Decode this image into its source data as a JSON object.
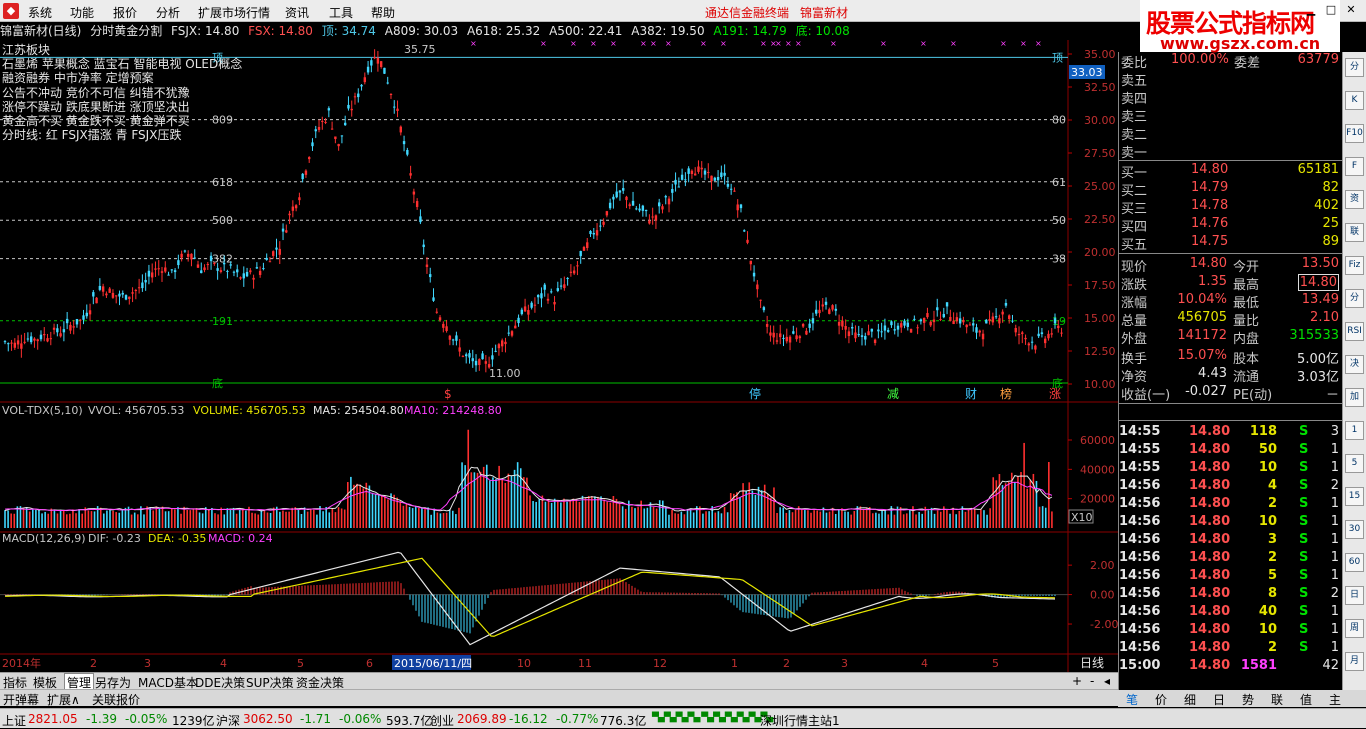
{
  "menu": {
    "items": [
      "系统",
      "功能",
      "报价",
      "分析",
      "扩展市场行情",
      "资讯",
      "工具",
      "帮助"
    ],
    "promo1": "通达信金融终端",
    "promo2": "锦富新材"
  },
  "banner": {
    "title": "股票公式指标网",
    "url": "www.gszx.com.cn"
  },
  "title": {
    "stock": "锦富新材(日线)",
    "indicator": "分时黄金分割",
    "fsjx": "FSJX: 14.80",
    "fsx": "FSX: 14.80",
    "top": "顶: 34.74",
    "a809": "A809: 30.03",
    "a618": "A618: 25.32",
    "a500": "A500: 22.41",
    "a382": "A382: 19.50",
    "a191": "A191: 14.79",
    "bottom": "底: 10.08"
  },
  "notes": [
    "江苏板块",
    "石墨烯 苹果概念 蓝宝石 智能电视 OLED概念",
    "融资融券 中市净率 定增预案",
    "公告不冲动 竞价不可信 纠错不犹豫",
    "涨停不躁动 跌底果断进 涨顶坚决出",
    "黄金高不买 黄金跌不买 黄金弹不买",
    "分时线: 红 FSJX擂涨 青 FSJX压跌"
  ],
  "chart_data": [
    {
      "type": "candlestick",
      "panel": "main",
      "y_axis_ticks": [
        "35.00",
        "32.50",
        "30.00",
        "27.50",
        "25.00",
        "22.50",
        "20.00",
        "17.50",
        "15.00",
        "12.50",
        "10.00"
      ],
      "ylim": [
        10,
        35.5
      ],
      "current_price_tag": "33.03",
      "high_label": "35.75",
      "low_label": "11.00",
      "levels": [
        {
          "value": 34.74,
          "left": "顶",
          "right": "顶",
          "color": "#4ec8e8"
        },
        {
          "value": 30.03,
          "left": "809",
          "right": "80",
          "color": "#c8c8c8"
        },
        {
          "value": 25.32,
          "left": "618",
          "right": "61",
          "color": "#c8c8c8"
        },
        {
          "value": 22.41,
          "left": "500",
          "right": "50",
          "color": "#c8c8c8"
        },
        {
          "value": 19.5,
          "left": "382",
          "right": "38",
          "color": "#c8c8c8"
        },
        {
          "value": 14.79,
          "left": "191",
          "right": "19",
          "color": "#00c000"
        },
        {
          "value": 10.08,
          "left": "底",
          "right": "底",
          "color": "#00c000"
        }
      ],
      "event_marks": [
        {
          "label": "$",
          "color": "#ff4040"
        },
        {
          "label": "停",
          "color": "#40c8ff"
        },
        {
          "label": "减",
          "color": "#40ff40"
        },
        {
          "label": "财",
          "color": "#40c8ff"
        },
        {
          "label": "榜",
          "color": "#ffa040"
        },
        {
          "label": "涨",
          "color": "#ff4040"
        }
      ],
      "close_path": [
        13.2,
        13.0,
        13.5,
        13.4,
        13.7,
        13.9,
        14.1,
        14.6,
        14.9,
        16.5,
        17.4,
        16.8,
        16.6,
        17.0,
        17.3,
        18.5,
        18.9,
        18.3,
        19.6,
        20.0,
        18.7,
        19.0,
        18.8,
        18.6,
        18.0,
        18.3,
        18.6,
        19.7,
        20.5,
        22.8,
        24.5,
        27.5,
        29.5,
        30.5,
        28.0,
        30.5,
        32.0,
        34.0,
        35.0,
        33.0,
        30.5,
        27.0,
        23.5,
        19.0,
        15.5,
        14.5,
        13.0,
        12.0,
        11.5,
        11.5,
        12.5,
        13.5,
        14.5,
        15.5,
        16.0,
        17.0,
        16.5,
        17.5,
        18.5,
        20.0,
        21.5,
        22.5,
        24.0,
        24.5,
        23.5,
        23.0,
        22.5,
        23.5,
        24.5,
        25.5,
        26.5,
        26.0,
        25.5,
        25.8,
        25.0,
        23.0,
        19.5,
        16.0,
        13.8,
        13.5,
        13.6,
        14.0,
        14.5,
        15.5,
        16.0,
        15.0,
        14.0,
        13.5,
        13.8,
        13.6,
        14.2,
        14.5,
        14.6,
        14.5,
        15.0,
        15.2,
        15.5,
        15.0,
        14.5,
        14.0,
        14.3,
        15.0,
        16.0,
        14.0,
        13.5,
        13.2,
        13.5,
        14.2
      ]
    },
    {
      "type": "bar",
      "panel": "volume",
      "title": "VOL-TDX(5,10)",
      "vvol": "VVOL: 456705.53",
      "volume": "VOLUME: 456705.53",
      "ma5": "MA5: 254504.80",
      "ma10": "MA10: 214248.80",
      "y_axis_ticks": [
        "60000",
        "40000",
        "20000"
      ],
      "unit": "X10",
      "ylim": [
        0,
        75000
      ]
    },
    {
      "type": "line",
      "panel": "macd",
      "title": "MACD(12,26,9)",
      "dif": "DIF: -0.23",
      "dea": "DEA: -0.35",
      "macd": "MACD: 0.24",
      "y_axis_ticks": [
        "2.00",
        "0.00",
        "-2.00"
      ],
      "ylim": [
        -3.9,
        3.3
      ]
    }
  ],
  "xaxis": {
    "labels": [
      "2014年",
      "2",
      "3",
      "4",
      "5",
      "6",
      "2015/06/11/四",
      "10",
      "11",
      "12",
      "1",
      "2",
      "3",
      "4",
      "5"
    ],
    "period": "日线"
  },
  "quote": {
    "ratio_label": "委比",
    "ratio": "100.00%",
    "diff_label": "委差",
    "diff": "63779",
    "sell": [
      {
        "label": "卖五"
      },
      {
        "label": "卖四"
      },
      {
        "label": "卖三"
      },
      {
        "label": "卖二"
      },
      {
        "label": "卖一"
      }
    ],
    "buy": [
      {
        "label": "买一",
        "price": "14.80",
        "vol": "65181"
      },
      {
        "label": "买二",
        "price": "14.79",
        "vol": "82"
      },
      {
        "label": "买三",
        "price": "14.78",
        "vol": "402"
      },
      {
        "label": "买四",
        "price": "14.76",
        "vol": "25"
      },
      {
        "label": "买五",
        "price": "14.75",
        "vol": "89"
      }
    ],
    "stats": [
      {
        "l1": "现价",
        "v1": "14.80",
        "l2": "今开",
        "v2": "13.50"
      },
      {
        "l1": "涨跌",
        "v1": "1.35",
        "l2": "最高",
        "v2": "14.80"
      },
      {
        "l1": "涨幅",
        "v1": "10.04%",
        "l2": "最低",
        "v2": "13.49"
      },
      {
        "l1": "总量",
        "v1": "456705",
        "l2": "量比",
        "v2": "2.10"
      },
      {
        "l1": "外盘",
        "v1": "141172",
        "l2": "内盘",
        "v2": "315533"
      },
      {
        "l1": "换手",
        "v1": "15.07%",
        "l2": "股本",
        "v2": "5.00亿"
      },
      {
        "l1": "净资",
        "v1": "4.43",
        "l2": "流通",
        "v2": "3.03亿"
      },
      {
        "l1": "收益(一)",
        "v1": "-0.027",
        "l2": "PE(动)",
        "v2": "－"
      }
    ],
    "ticks": [
      {
        "time": "14:55",
        "price": "14.80",
        "vol": "118",
        "side": "S",
        "n": "3"
      },
      {
        "time": "14:55",
        "price": "14.80",
        "vol": "50",
        "side": "S",
        "n": "1"
      },
      {
        "time": "14:55",
        "price": "14.80",
        "vol": "10",
        "side": "S",
        "n": "1"
      },
      {
        "time": "14:56",
        "price": "14.80",
        "vol": "4",
        "side": "S",
        "n": "2"
      },
      {
        "time": "14:56",
        "price": "14.80",
        "vol": "2",
        "side": "S",
        "n": "1"
      },
      {
        "time": "14:56",
        "price": "14.80",
        "vol": "10",
        "side": "S",
        "n": "1"
      },
      {
        "time": "14:56",
        "price": "14.80",
        "vol": "3",
        "side": "S",
        "n": "1"
      },
      {
        "time": "14:56",
        "price": "14.80",
        "vol": "2",
        "side": "S",
        "n": "1"
      },
      {
        "time": "14:56",
        "price": "14.80",
        "vol": "5",
        "side": "S",
        "n": "1"
      },
      {
        "time": "14:56",
        "price": "14.80",
        "vol": "8",
        "side": "S",
        "n": "2"
      },
      {
        "time": "14:56",
        "price": "14.80",
        "vol": "40",
        "side": "S",
        "n": "1"
      },
      {
        "time": "14:56",
        "price": "14.80",
        "vol": "10",
        "side": "S",
        "n": "1"
      },
      {
        "time": "14:56",
        "price": "14.80",
        "vol": "2",
        "side": "S",
        "n": "1"
      },
      {
        "time": "15:00",
        "price": "14.80",
        "vol": "1581",
        "side": "",
        "n": "42"
      }
    ]
  },
  "tabs1": [
    "指标",
    "模板",
    "管理",
    "另存为",
    "MACD基本",
    "DDE决策",
    "SUP决策",
    "资金决策"
  ],
  "tabs2": [
    "开弹幕",
    "扩展∧",
    "关联报价"
  ],
  "rtabs": [
    "笔",
    "价",
    "细",
    "日",
    "势",
    "联",
    "值",
    "主"
  ],
  "status": {
    "sh_label": "上证",
    "sh": "2821.05",
    "sh_chg": "-1.39",
    "sh_pct": "-0.05%",
    "sh_amt": "1239亿",
    "sz_label": "沪深",
    "sz": "3062.50",
    "sz_chg": "-1.71",
    "sz_pct": "-0.06%",
    "sz_amt": "593.7亿",
    "cy_label": "创业",
    "cy": "2069.89",
    "cy_chg": "-16.12",
    "cy_pct": "-0.77%",
    "cy_amt": "776.3亿",
    "server": "深圳行情主站1"
  },
  "toolstrip": [
    "分",
    "K",
    "F10",
    "F",
    "资",
    "联",
    "Fiz",
    "分",
    "RSI",
    "决",
    "加",
    "1",
    "5",
    "15",
    "30",
    "60",
    "日",
    "周",
    "月"
  ]
}
